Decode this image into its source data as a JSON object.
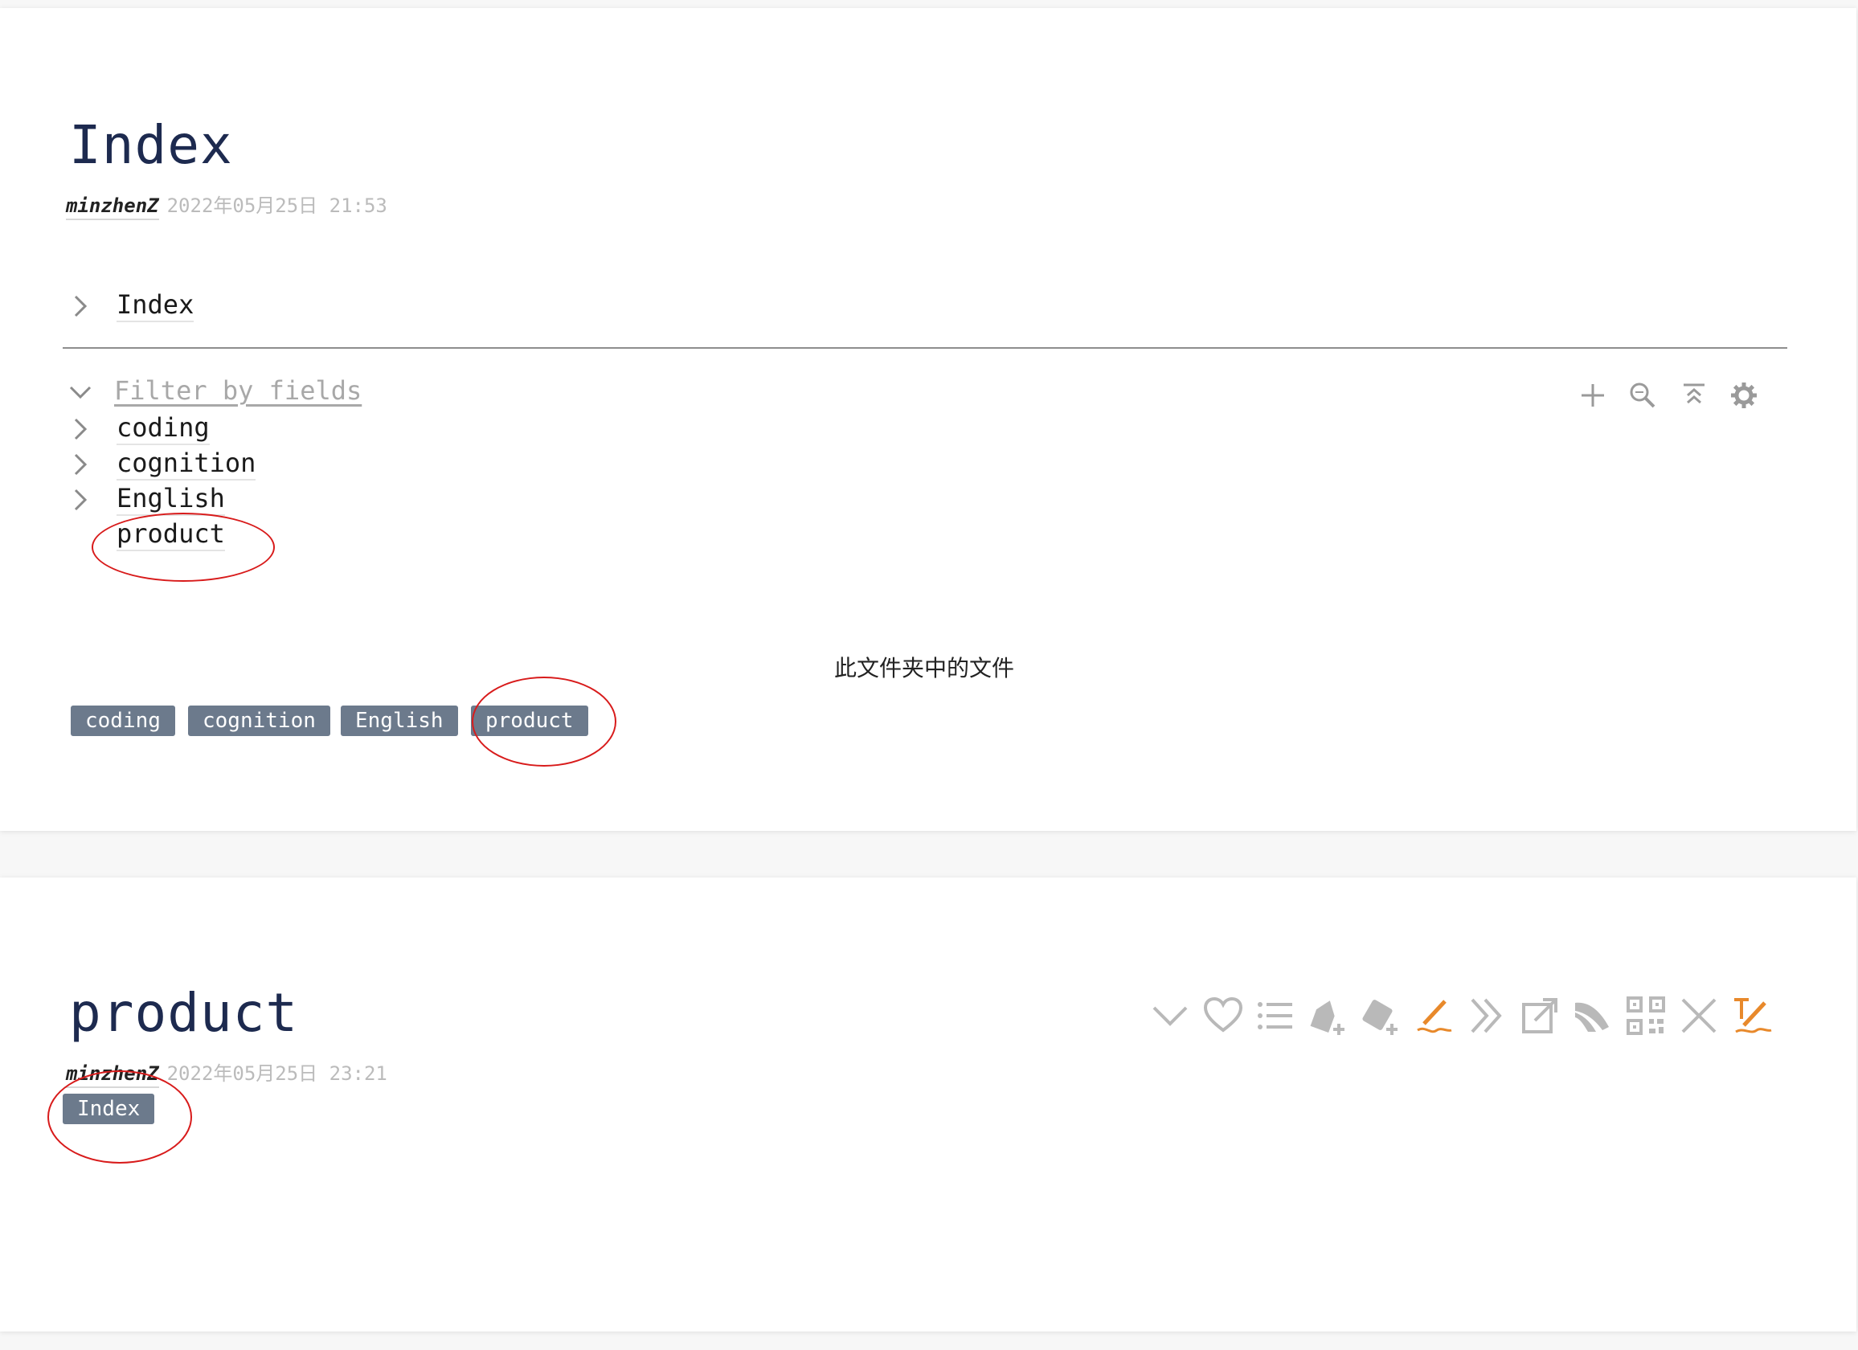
{
  "index_card": {
    "title": "Index",
    "author": "minzhenZ",
    "timestamp": "2022年05月25日 21:53",
    "breadcrumb_item": "Index",
    "filter_link": "Filter by fields",
    "tree_items": [
      {
        "label": "coding",
        "expandable": true
      },
      {
        "label": "cognition",
        "expandable": true
      },
      {
        "label": "English",
        "expandable": true
      },
      {
        "label": "product",
        "expandable": false
      }
    ],
    "toolbar_icons": [
      "plus-icon",
      "zoom-icon",
      "collapse-all-icon",
      "gear-icon"
    ],
    "folder_caption": "此文件夹中的文件",
    "tags": [
      "coding",
      "cognition",
      "English",
      "product"
    ]
  },
  "product_card": {
    "title": "product",
    "author": "minzhenZ",
    "timestamp": "2022年05月25日 23:21",
    "tag": "Index",
    "action_icons": [
      "chevron-down-icon",
      "heart-icon",
      "list-icon",
      "add-tag-icon",
      "calendar-tag-icon",
      "edit-pen-icon",
      "double-chevron-icon",
      "external-link-icon",
      "shell-icon",
      "qr-code-icon",
      "close-icon",
      "edit-text-icon"
    ]
  },
  "colors": {
    "title": "#1d2a4f",
    "tag_bg": "#6c7a8c",
    "annotation": "#d81b1b",
    "accent_orange": "#e8892b",
    "icon_gray": "#b9b9b9"
  }
}
